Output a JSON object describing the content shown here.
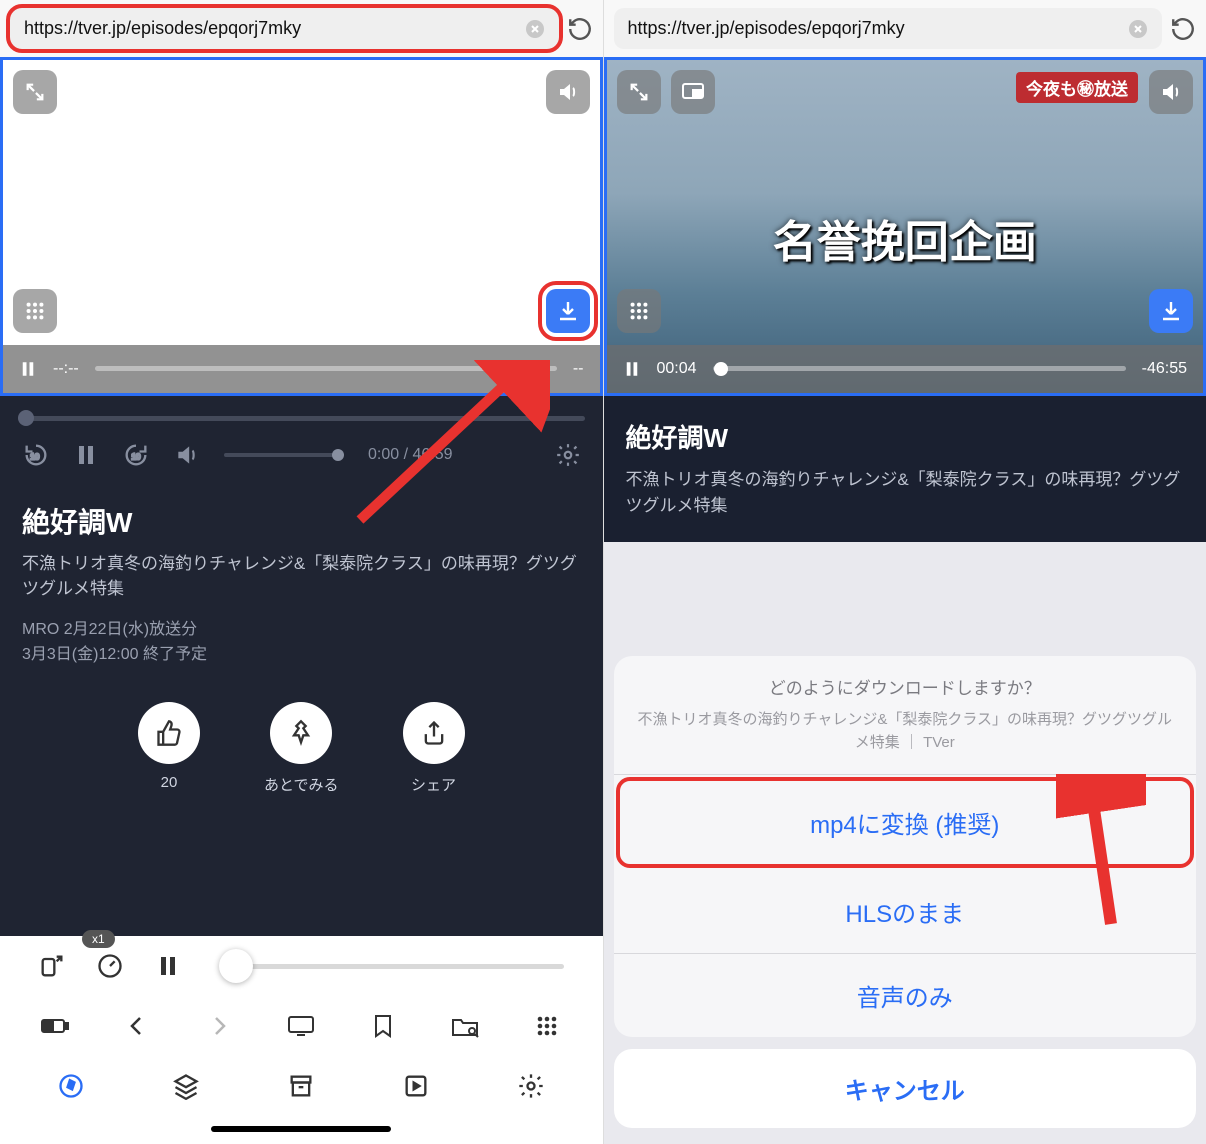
{
  "left": {
    "url": "https://tver.jp/episodes/epqorj7mky",
    "player": {
      "time_left": "--:--",
      "time_right": "--"
    },
    "inner_player_time": "0:00 / 46:59",
    "title": "絶好調W",
    "subtitle": "不漁トリオ真冬の海釣りチャレンジ&「梨泰院クラス」の味再現？グツグツグルメ特集",
    "meta_line1": "MRO 2月22日(水)放送分",
    "meta_line2": "3月3日(金)12:00 終了予定",
    "actions": {
      "like_count": "20",
      "watch_later": "あとでみる",
      "share": "シェア"
    },
    "speed_badge": "x1"
  },
  "right": {
    "url": "https://tver.jp/episodes/epqorj7mky",
    "overlay_banner": "今夜も㊙放送",
    "overlay_title": "名誉挽回企画",
    "player": {
      "time_left": "00:04",
      "time_right": "-46:55"
    },
    "title": "絶好調W",
    "subtitle": "不漁トリオ真冬の海釣りチャレンジ&「梨泰院クラス」の味再現？グツグツグルメ特集",
    "sheet": {
      "question": "どのようにダウンロードしますか？",
      "desc": "不漁トリオ真冬の海釣りチャレンジ&「梨泰院クラス」の味再現？グツグツグルメ特集 ｜ TVer",
      "options": [
        "mp4に変換 (推奨)",
        "HLSのまま",
        "音声のみ"
      ],
      "cancel": "キャンセル"
    }
  }
}
